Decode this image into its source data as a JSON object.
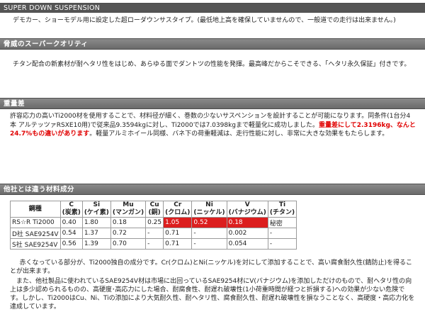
{
  "header": {
    "title": "SUPER DOWN SUSPENSION"
  },
  "intro": {
    "text": "デモカー、ショーモデル用に設定した超ローダウンサスタイプ。(最低地上高を確保していませんので、一般道での走行は出来ません。)"
  },
  "sections": [
    {
      "title": "脅威のスーパークオリティ",
      "body": "チタン配合の新素材が耐ヘタリ性をはじめ、あらゆる面でダントツの性能を発揮。最高峰だからこそできる、「ヘタリ永久保証」付きです。"
    },
    {
      "title": "重量差",
      "body_pre": "許容応力の高いTi2000材を使用することで、材料径が細く、巻数の少ないサスペンションを設計することが可能になります。同条件(1台分4本 アルテッツァRSXE10用)で従来品9.3594kgに対し、Ti2000では7.0398kgまで軽量化に成功しました。",
      "body_red": "重量差にして2.3196kg、なんと24.7%もの違いがあります",
      "body_post": "。軽量アルミホイール同様、バネ下の荷重軽減は、走行性能に対し、非常に大きな効果をもたらします。"
    },
    {
      "title": "他社とは違う材料成分"
    }
  ],
  "table": {
    "headers": [
      {
        "line1": "鋼種",
        "line2": ""
      },
      {
        "line1": "C",
        "line2": "(炭素)"
      },
      {
        "line1": "Si",
        "line2": "(ケイ素)"
      },
      {
        "line1": "Mu",
        "line2": "(マンガン)"
      },
      {
        "line1": "Cu",
        "line2": "(銅)"
      },
      {
        "line1": "Cr",
        "line2": "(クロム)"
      },
      {
        "line1": "Ni",
        "line2": "(ニッケル)"
      },
      {
        "line1": "V",
        "line2": "(バナジウム)"
      },
      {
        "line1": "Ti",
        "line2": "(チタン)"
      }
    ],
    "rows": [
      [
        "RS☆R Ti2000",
        "0.40",
        "1.80",
        "0.18",
        "0.25",
        "1.05",
        "0.52",
        "0.18",
        "秘密"
      ],
      [
        "D社 SAE9254V",
        "0.54",
        "1.37",
        "0.72",
        "-",
        "0.71",
        "-",
        "0.002",
        "-"
      ],
      [
        "S社 SAE9254V",
        "0.56",
        "1.39",
        "0.70",
        "-",
        "0.71",
        "-",
        "0.054",
        "-"
      ]
    ],
    "highlight_color": "#dc1e1e"
  },
  "footer": {
    "p1": "赤くなっている部分が、Ti2000独自の成分です。Cr(クロム)とNi(ニッケル)を対にして添加することで、高い腐食耐久性(錆防止)を得ることが出来ます。",
    "p2": "また、他社製品に使われているSAE9254V材は市場に出回っているSAE9254材にV(バナジウム)を添加しただけのもので、耐ヘタリ性の向上は多少認められるものの、高硬度･高応力にした場合、耐腐食性、耐遅れ破壊性(1小荷重時間が経つと折損する)への効果が少ない危険です。しかし、Ti2000はCu、Ni、Tiの添加により大気耐久性、耐ヘタリ性、腐食耐久性、耐遅れ破壊性を損なうことなく、高硬度・高応力化を達成しています。"
  }
}
